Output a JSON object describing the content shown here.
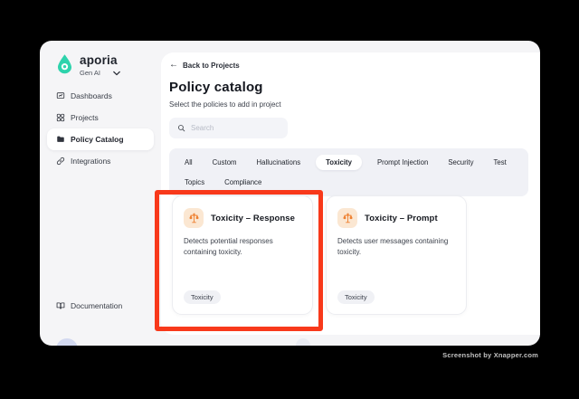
{
  "brand": {
    "name": "aporia",
    "workspace": "Gen AI"
  },
  "sidebar": {
    "items": [
      {
        "label": "Dashboards",
        "icon": "dashboards-icon",
        "active": false
      },
      {
        "label": "Projects",
        "icon": "projects-icon",
        "active": false
      },
      {
        "label": "Policy Catalog",
        "icon": "folder-icon",
        "active": true
      },
      {
        "label": "Integrations",
        "icon": "link-icon",
        "active": false
      }
    ],
    "documentation_label": "Documentation"
  },
  "main": {
    "back_link": "Back to Projects",
    "title": "Policy catalog",
    "subtitle": "Select the policies to add in project",
    "search": {
      "placeholder": "Search"
    },
    "tabs": [
      {
        "label": "All",
        "active": false
      },
      {
        "label": "Custom",
        "active": false
      },
      {
        "label": "Hallucinations",
        "active": false
      },
      {
        "label": "Toxicity",
        "active": true
      },
      {
        "label": "Prompt Injection",
        "active": false
      },
      {
        "label": "Security",
        "active": false
      },
      {
        "label": "Test",
        "active": false
      },
      {
        "label": "Topics",
        "active": false
      },
      {
        "label": "Compliance",
        "active": false
      }
    ],
    "cards": [
      {
        "title": "Toxicity – Response",
        "description": "Detects potential responses containing toxicity.",
        "tag": "Toxicity",
        "icon": "scales-icon",
        "highlighted": true
      },
      {
        "title": "Toxicity – Prompt",
        "description": "Detects user messages containing toxicity.",
        "tag": "Toxicity",
        "icon": "scales-icon",
        "highlighted": false
      }
    ]
  },
  "watermark": "Screenshot by Xnapper.com",
  "colors": {
    "accent_teal": "#2ED3AC",
    "highlight_red": "#F8391B",
    "icon_orange": "#EE7F2F",
    "icon_orange_bg": "#FBE7D2",
    "window_bg": "#F5F5F7"
  }
}
